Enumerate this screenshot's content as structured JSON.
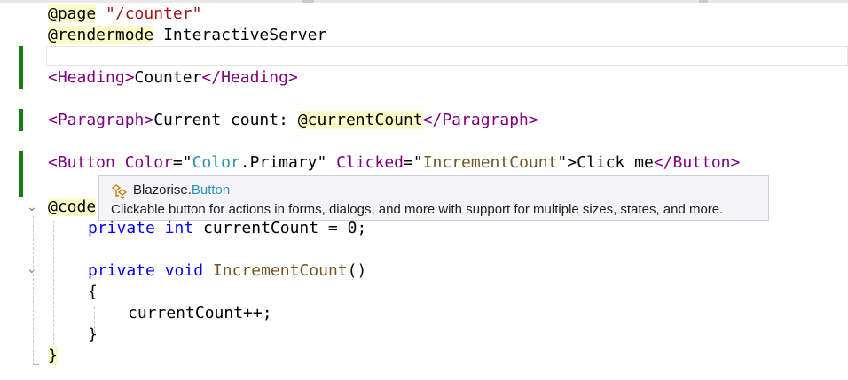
{
  "editor": {
    "line1": {
      "directive": "@page",
      "value": "\"/counter\""
    },
    "line2": {
      "directive": "@rendermode",
      "value": "InteractiveServer"
    },
    "heading": {
      "open": "<Heading>",
      "text": "Counter",
      "close": "</Heading>"
    },
    "paragraph": {
      "open": "<Paragraph>",
      "text": "Current count: ",
      "expr": "@currentCount",
      "close": "</Paragraph>"
    },
    "button": {
      "open_tag": "<Button",
      "attr1": "Color",
      "attr1_eq": "=\"",
      "attr1_type": "Color",
      "attr1_member": ".Primary",
      "attr1_end": "\"",
      "attr2": "Clicked",
      "attr2_eq": "=\"",
      "attr2_value": "IncrementCount",
      "attr2_end": "\">",
      "text": "Click me",
      "close": "</Button>"
    },
    "code_keyword": "@code",
    "field": {
      "mod": "private",
      "type": "int",
      "rest": " currentCount = 0;"
    },
    "method": {
      "mod": "private",
      "type": "void",
      "name": "IncrementCount",
      "parens": "()"
    },
    "open_brace": "{",
    "stmt": "currentCount++;",
    "close_brace": "}",
    "final_brace": "}"
  },
  "tooltip": {
    "namespace": "Blazorise.",
    "class_name": "Button",
    "description": "Clickable button for actions in forms, dialogs, and more with support for multiple sizes, states, and more."
  },
  "colors": {
    "string": "#a31515",
    "tag": "#800080",
    "keyword": "#0000ff",
    "type": "#2b91af",
    "method": "#74531f",
    "change_marker": "#108010"
  }
}
